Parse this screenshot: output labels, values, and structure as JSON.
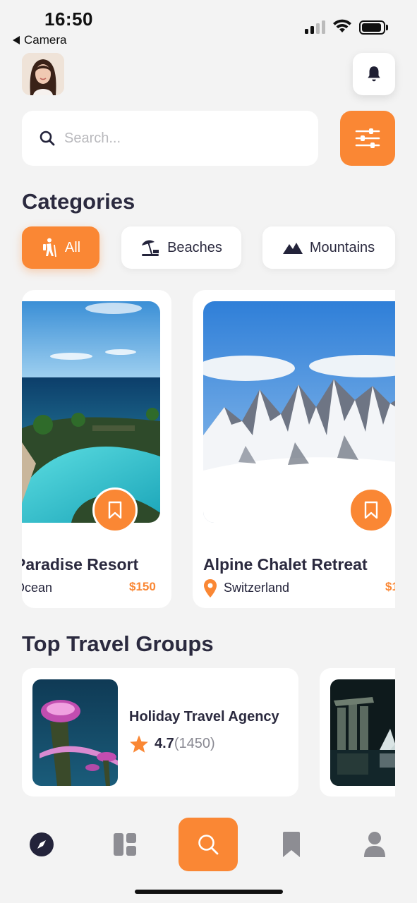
{
  "status_bar": {
    "time": "16:50",
    "back_app": "Camera"
  },
  "header": {
    "avatar_alt": "user-avatar",
    "notification_icon": "bell-icon"
  },
  "search": {
    "placeholder": "Search...",
    "value": ""
  },
  "categories": {
    "title": "Categories",
    "chips": [
      {
        "label": "All",
        "icon": "hiker-icon",
        "active": true
      },
      {
        "label": "Beaches",
        "icon": "beach-umbrella-icon",
        "active": false
      },
      {
        "label": "Mountains",
        "icon": "mountain-icon",
        "active": false
      }
    ]
  },
  "places": [
    {
      "title": "Paradise Resort",
      "location": "Ocean",
      "price": "$150"
    },
    {
      "title": "Alpine Chalet Retreat",
      "location": "Switzerland",
      "price": "$1"
    }
  ],
  "groups": {
    "title": "Top Travel Groups",
    "items": [
      {
        "name": "Holiday Travel Agency",
        "rating": "4.7",
        "reviews": "(1450)"
      }
    ]
  },
  "colors": {
    "accent": "#fa8734",
    "background": "#f3f3f3",
    "text": "#2b2a3f"
  },
  "tabbar": [
    "compass-icon",
    "dashboard-icon",
    "search-icon",
    "bookmark-icon",
    "profile-icon"
  ]
}
